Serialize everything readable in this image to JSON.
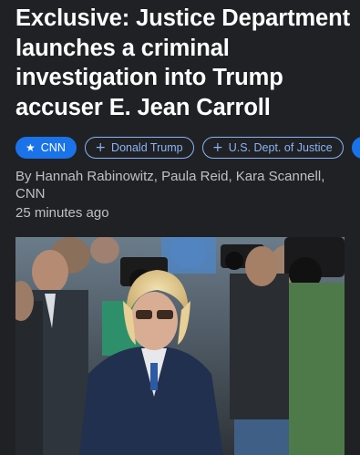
{
  "article": {
    "headline": "Exclusive: Justice Department launches a criminal investigation into Trump accuser E. Jean Carroll",
    "byline": "By Hannah Rabinowitz, Paula Reid, Kara Scannell, CNN",
    "timestamp": "25 minutes ago"
  },
  "topics": [
    {
      "label": "CNN",
      "icon": "star-icon",
      "style": "filled"
    },
    {
      "label": "Donald Trump",
      "icon": "plus-icon",
      "style": "outline"
    },
    {
      "label": "U.S. Dept. of Justice",
      "icon": "plus-icon",
      "style": "outline"
    },
    {
      "label": "",
      "icon": "plus-icon",
      "style": "filled"
    }
  ],
  "colors": {
    "background": "#202124",
    "accent": "#1a73e8",
    "chip_outline": "#8ab4f8"
  }
}
